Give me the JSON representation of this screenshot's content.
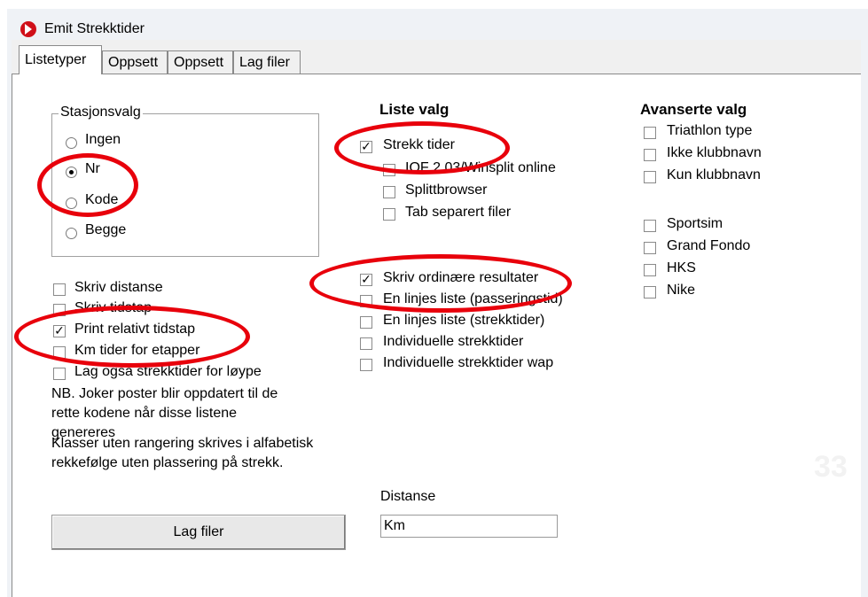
{
  "window": {
    "title": "Emit Strekktider"
  },
  "tabs": [
    {
      "label": "Listetyper",
      "active": true
    },
    {
      "label": "Oppsett",
      "active": false
    },
    {
      "label": "Oppsett",
      "active": false
    },
    {
      "label": "Lag filer",
      "active": false
    }
  ],
  "stasjonsvalg": {
    "label": "Stasjonsvalg",
    "options": [
      {
        "label": "Ingen",
        "selected": false
      },
      {
        "label": "Nr",
        "selected": true
      },
      {
        "label": "Kode",
        "selected": false
      },
      {
        "label": "Begge",
        "selected": false
      }
    ]
  },
  "left_options": [
    {
      "label": "Skriv distanse",
      "checked": false
    },
    {
      "label": "Skriv tidstap",
      "checked": false
    },
    {
      "label": "Print relativt tidstap",
      "checked": true
    },
    {
      "label": "Km tider for etapper",
      "checked": false
    },
    {
      "label": "Lag også strekktider for løype",
      "checked": false
    }
  ],
  "notes": {
    "joker": "NB. Joker poster blir oppdatert til de rette kodene når disse listene genereres",
    "klasser": "Klasser uten  rangering skrives  i alfabetisk rekkefølge uten plassering på strekk."
  },
  "liste_valg": {
    "heading": "Liste valg",
    "group1": [
      {
        "label": "Strekk tider",
        "checked": true
      },
      {
        "label": "IOF 2.03/Winsplit online",
        "checked": false
      },
      {
        "label": "Splittbrowser",
        "checked": false
      },
      {
        "label": "Tab separert filer",
        "checked": false
      }
    ],
    "group2": [
      {
        "label": "Skriv ordinære resultater",
        "checked": true
      },
      {
        "label": "En linjes liste (passeringstid)",
        "checked": false
      },
      {
        "label": "En linjes liste (strekktider)",
        "checked": false
      },
      {
        "label": "Individuelle strekktider",
        "checked": false
      },
      {
        "label": "Individuelle strekktider wap",
        "checked": false
      }
    ]
  },
  "avanserte_valg": {
    "heading": "Avanserte valg",
    "group1": [
      {
        "label": "Triathlon type",
        "checked": false
      },
      {
        "label": "Ikke klubbnavn",
        "checked": false
      },
      {
        "label": "Kun klubbnavn",
        "checked": false
      }
    ],
    "group2": [
      {
        "label": "Sportsim",
        "checked": false
      },
      {
        "label": "Grand Fondo",
        "checked": false
      },
      {
        "label": "HKS",
        "checked": false
      },
      {
        "label": "Nike",
        "checked": false
      }
    ]
  },
  "distanse": {
    "label": "Distanse",
    "value": "Km"
  },
  "lag_filer_button": "Lag filer",
  "page_number": "33",
  "colors": {
    "highlight_ring": "#e8000b",
    "window_bg": "#f0f0f0"
  }
}
